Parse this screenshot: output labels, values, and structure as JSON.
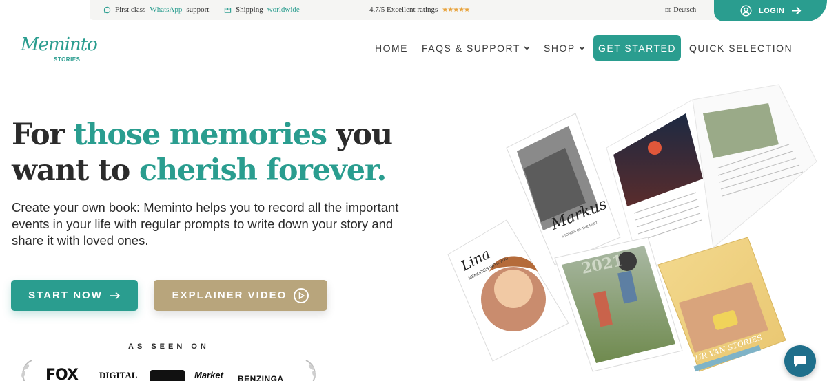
{
  "topbar": {
    "support_prefix": "First class",
    "support_highlight": "WhatsApp",
    "support_suffix": "support",
    "shipping_prefix": "Shipping",
    "shipping_highlight": "worldwide",
    "rating_text": "4,7/5 Excellent ratings",
    "stars": "★★★★★",
    "lang_code": "DE",
    "lang_label": "Deutsch",
    "login_label": "LOGIN"
  },
  "logo": {
    "script": "Meminto",
    "sub": "STORIES"
  },
  "nav": {
    "home": "HOME",
    "faqs": "FAQS & SUPPORT",
    "shop": "SHOP",
    "get_started": "GET STARTED",
    "quick": "QUICK SELECTION"
  },
  "hero": {
    "title_1a": "For ",
    "title_1b": "those memories",
    "title_1c": " you",
    "title_2a": "want to ",
    "title_2b": "cherish forever.",
    "subtitle": "Create your own book: Meminto helps you to record all the important events in your life with regular prompts to write down your story and share it with loved ones.",
    "start_label": "START NOW",
    "video_label": "EXPLAINER VIDEO"
  },
  "seen": {
    "label": "AS SEEN ON",
    "logos": [
      "FOX",
      "DIGITAL",
      "Market",
      "BENZINGA"
    ]
  },
  "books": {
    "name_1": "Markus",
    "caption_1": "STORIES OF THE PAST",
    "name_2": "Lina",
    "caption_2": "MEMORIES WITH YOU",
    "year": "2021",
    "title_3": "OUR VAN STORIES"
  },
  "colors": {
    "accent": "#2a9d8f",
    "gold": "#b8a57c",
    "chat": "#1f6f8b"
  },
  "icons": [
    "whatsapp-icon",
    "box-icon",
    "user-icon",
    "arrow-right-icon",
    "chevron-down-icon",
    "play-icon",
    "chat-icon"
  ]
}
